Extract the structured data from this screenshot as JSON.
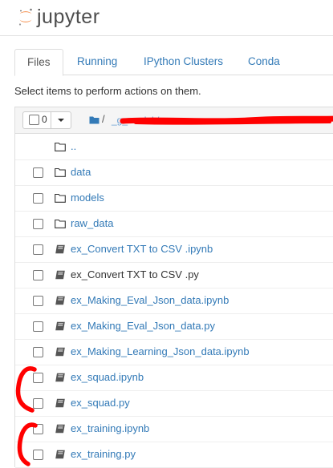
{
  "app": {
    "logo_text": "jupyter"
  },
  "tabs": [
    {
      "label": "Files",
      "active": true
    },
    {
      "label": "Running",
      "active": false
    },
    {
      "label": "IPython Clusters",
      "active": false
    },
    {
      "label": "Conda",
      "active": false
    }
  ],
  "hint": "Select items to perform actions on them.",
  "toolbar": {
    "selected_count": "0",
    "breadcrumb_sep": "/",
    "path_visible": "_g_model /"
  },
  "files": [
    {
      "name": "..",
      "icon": "folder-icon",
      "checkbox": false
    },
    {
      "name": "data",
      "icon": "folder-icon",
      "checkbox": true
    },
    {
      "name": "models",
      "icon": "folder-icon",
      "checkbox": true
    },
    {
      "name": "raw_data",
      "icon": "folder-icon",
      "checkbox": true
    },
    {
      "name": "ex_Convert TXT to CSV .ipynb",
      "icon": "notebook-icon",
      "checkbox": true
    },
    {
      "name": "ex_Convert TXT to CSV .py",
      "icon": "file-icon",
      "checkbox": true
    },
    {
      "name": "ex_Making_Eval_Json_data.ipynb",
      "icon": "notebook-icon",
      "checkbox": true
    },
    {
      "name": "ex_Making_Eval_Json_data.py",
      "icon": "file-icon",
      "checkbox": true
    },
    {
      "name": "ex_Making_Learning_Json_data.ipynb",
      "icon": "notebook-icon",
      "checkbox": true
    },
    {
      "name": "ex_squad.ipynb",
      "icon": "notebook-icon",
      "checkbox": true
    },
    {
      "name": "ex_squad.py",
      "icon": "file-icon",
      "checkbox": true
    },
    {
      "name": "ex_training.ipynb",
      "icon": "notebook-icon",
      "checkbox": true
    },
    {
      "name": "ex_training.py",
      "icon": "file-icon",
      "checkbox": true
    }
  ],
  "colors": {
    "link": "#337ab7",
    "accent": "#f37726",
    "annotation": "#ff0000"
  }
}
